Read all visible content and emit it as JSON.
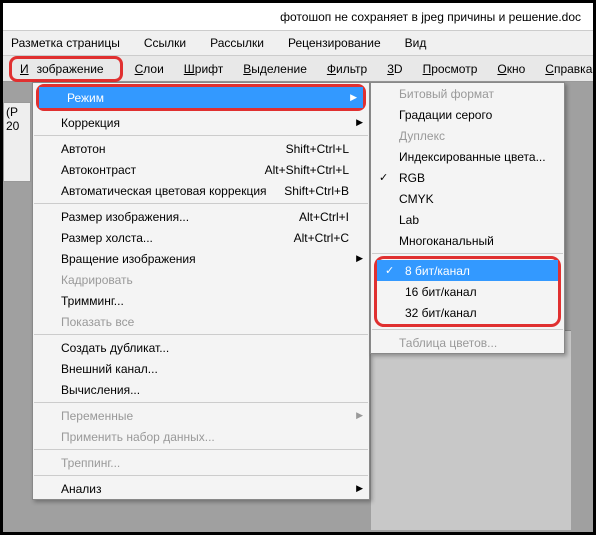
{
  "window": {
    "title": "фотошоп не сохраняет в jpeg причины и решение.doc"
  },
  "topMenu": {
    "items": [
      "Разметка страницы",
      "Ссылки",
      "Рассылки",
      "Рецензирование",
      "Вид"
    ]
  },
  "appMenu": {
    "image": "Изображение",
    "layers": "Слои",
    "font": "Шрифт",
    "select": "Выделение",
    "filter": "Фильтр",
    "threeD": "3D",
    "view": "Просмотр",
    "window": "Окно",
    "help": "Справка"
  },
  "sidebar": {
    "label1": "(P",
    "label2": "20"
  },
  "menu": {
    "mode": "Режим",
    "correction": "Коррекция",
    "autoTone": "Автотон",
    "autoToneKey": "Shift+Ctrl+L",
    "autoContrast": "Автоконтраст",
    "autoContrastKey": "Alt+Shift+Ctrl+L",
    "autoColor": "Автоматическая цветовая коррекция",
    "autoColorKey": "Shift+Ctrl+B",
    "imageSize": "Размер изображения...",
    "imageSizeKey": "Alt+Ctrl+I",
    "canvasSize": "Размер холста...",
    "canvasSizeKey": "Alt+Ctrl+C",
    "rotate": "Вращение изображения",
    "crop": "Кадрировать",
    "trim": "Тримминг...",
    "revealAll": "Показать все",
    "duplicate": "Создать дубликат...",
    "applyImage": "Внешний канал...",
    "calc": "Вычисления...",
    "variables": "Переменные",
    "applyData": "Применить набор данных...",
    "trap": "Треппинг...",
    "analysis": "Анализ"
  },
  "submenu": {
    "bitmap": "Битовый формат",
    "grayscale": "Градации серого",
    "duotone": "Дуплекс",
    "indexed": "Индексированные цвета...",
    "rgb": "RGB",
    "cmyk": "CMYK",
    "lab": "Lab",
    "multichannel": "Многоканальный",
    "bits8": "8 бит/канал",
    "bits16": "16 бит/канал",
    "bits32": "32 бит/канал",
    "colorTable": "Таблица цветов..."
  }
}
